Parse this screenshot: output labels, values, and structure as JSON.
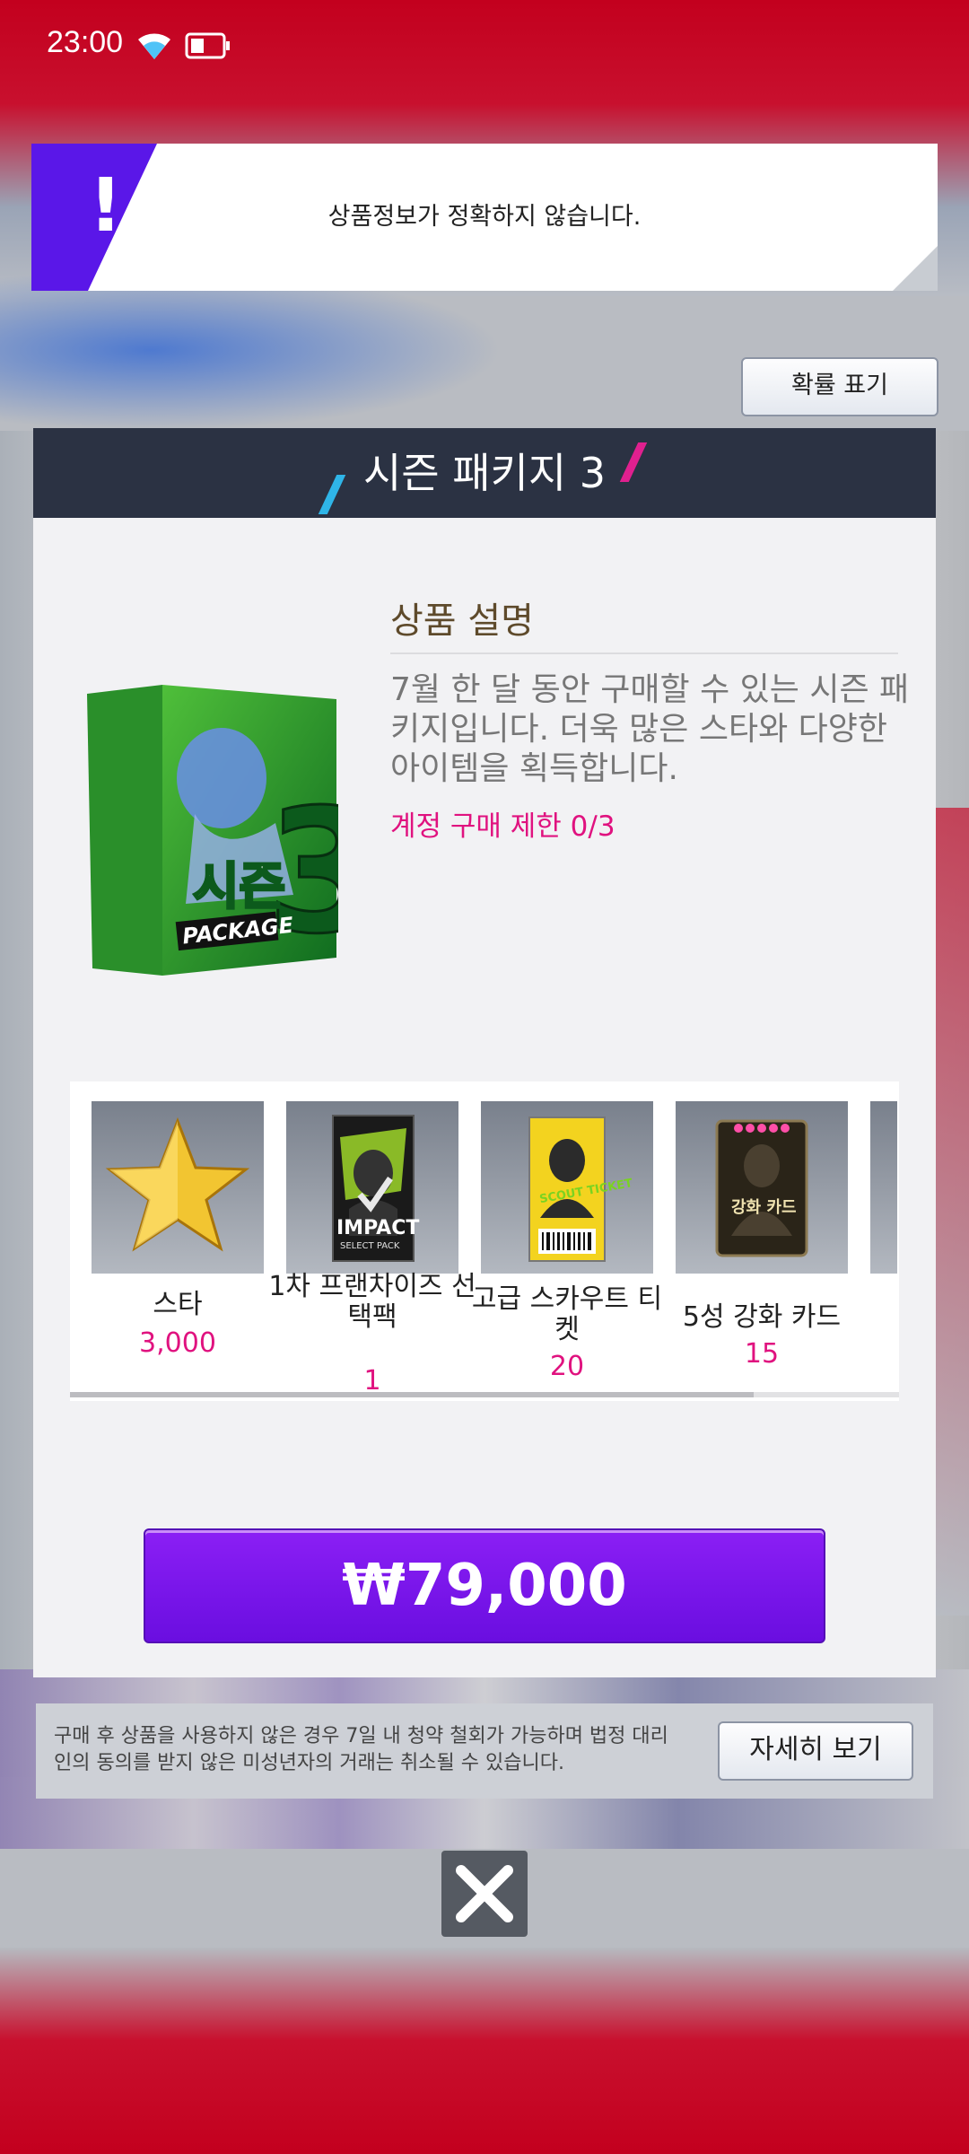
{
  "status_bar": {
    "time": "23:00",
    "icons": [
      "wifi-icon",
      "battery-icon"
    ]
  },
  "banner": {
    "icon": "!",
    "message": "상품정보가 정확하지 않습니다."
  },
  "probability_button": {
    "label": "확률 표기"
  },
  "package": {
    "title": "시즌 패키지 3",
    "art_text": {
      "number": "3",
      "korean": "시즌",
      "english": "PACKAGE"
    },
    "description_title": "상품 설명",
    "description": "7월 한 달 동안 구매할 수 있는 시즌 패키지입니다. 더욱 많은 스타와 다양한 아이템을 획득합니다.",
    "limit": "계정 구매 제한 0/3"
  },
  "rewards": [
    {
      "name": "스타",
      "qty": "3,000",
      "icon": "star-icon"
    },
    {
      "name": "1차 프랜차이즈 선택팩",
      "qty": "1",
      "icon": "impact-pack-icon",
      "art_text": "IMPACT",
      "art_sub": "SELECT PACK"
    },
    {
      "name": "고급 스카우트 티켓",
      "qty": "20",
      "icon": "scout-ticket-icon",
      "art_text": "SCOUT TICKET"
    },
    {
      "name": "5성 강화 카드",
      "qty": "15",
      "icon": "upgrade-card-icon",
      "art_text": "강화 카드"
    }
  ],
  "buy_button": {
    "label": "₩79,000"
  },
  "notice": {
    "text": "구매 후 상품을 사용하지 않은 경우 7일 내 청약 철회가 가능하며 법정 대리인의 동의를 받지 않은 미성년자의 거래는 취소될 수 있습니다.",
    "detail_label": "자세히 보기"
  },
  "close_button": {
    "icon": "close-icon"
  },
  "colors": {
    "accent": "#6a0ee0",
    "highlight": "#e0127f",
    "header": "#2b3243"
  }
}
